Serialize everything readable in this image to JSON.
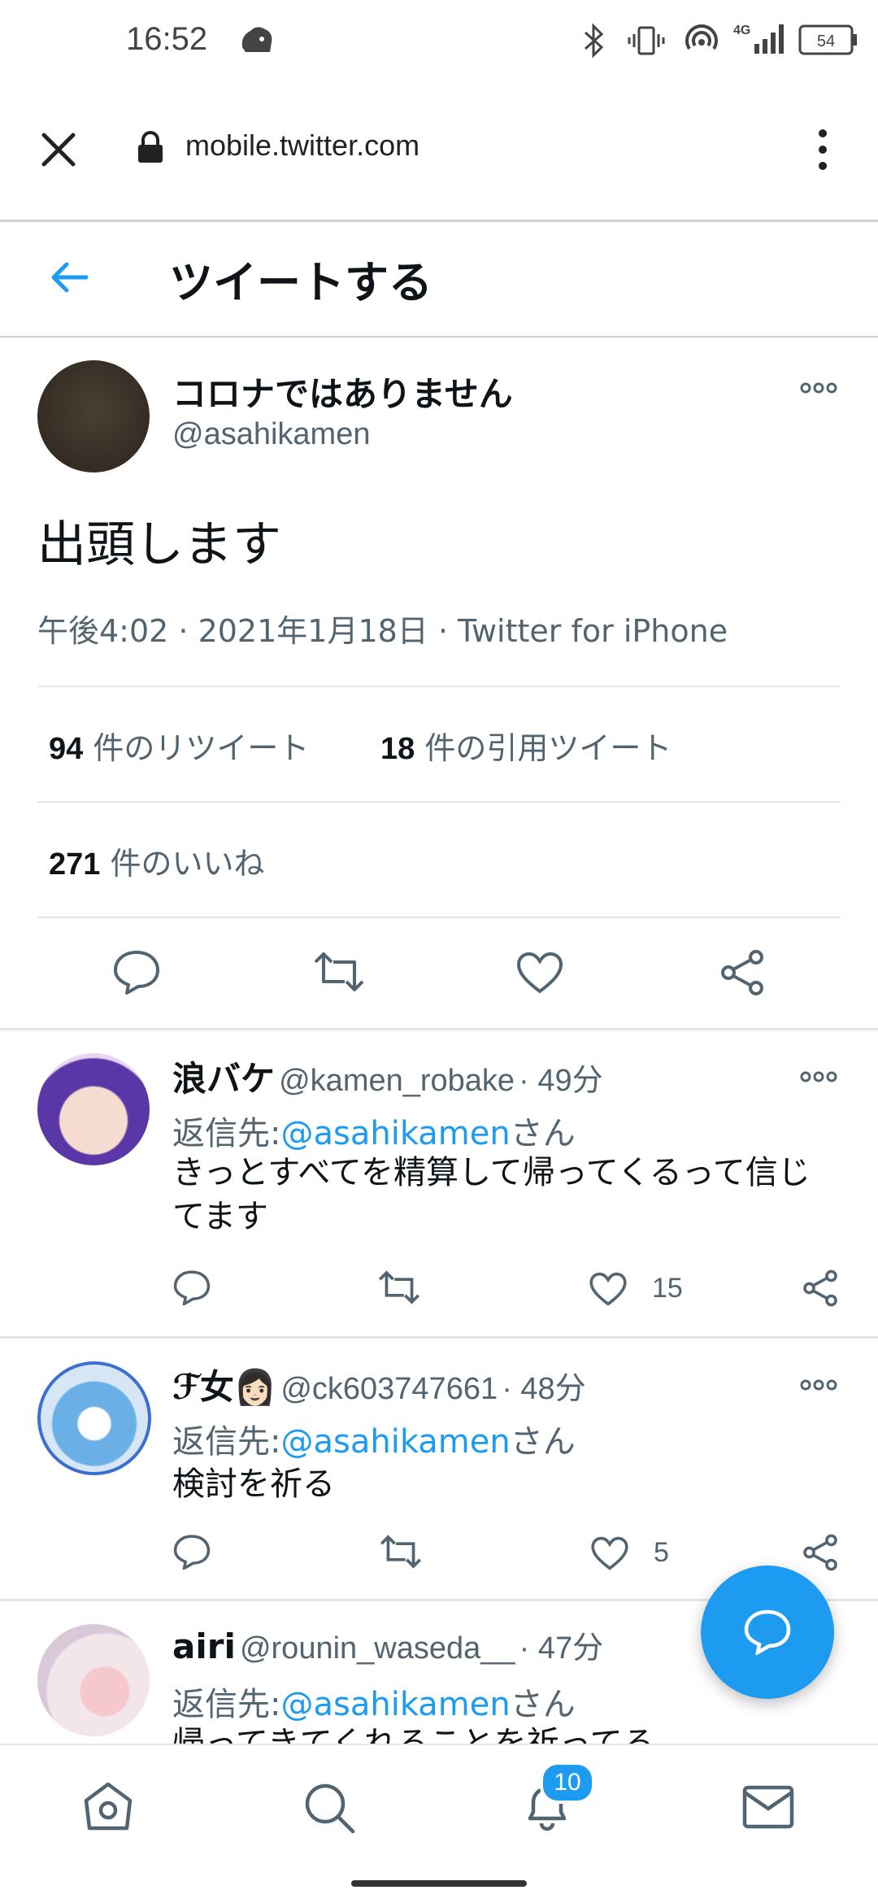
{
  "status_bar": {
    "time": "16:52",
    "battery": "54",
    "network": "4G"
  },
  "browser": {
    "url": "mobile.twitter.com"
  },
  "header": {
    "title": "ツイートする"
  },
  "tweet": {
    "display_name": "コロナではありません",
    "handle": "@asahikamen",
    "text": "出頭します",
    "meta": "午後4:02 · 2021年1月18日 · Twitter for iPhone",
    "retweets_count": "94",
    "retweets_label": "件のリツイート",
    "quotes_count": "18",
    "quotes_label": "件の引用ツイート",
    "likes_count": "271",
    "likes_label": "件のいいね"
  },
  "replies": [
    {
      "display_name": "浪バケ",
      "handle": "@kamen_robake",
      "time": "· 49分",
      "reply_to_prefix": "返信先:",
      "reply_to_handle": "@asahikamen",
      "reply_to_suffix": "さん",
      "text_line1": "きっとすべてを精算して帰ってくるって信じ",
      "text_line2": "てます",
      "likes": "15"
    },
    {
      "display_name": "ℱ女👩🏻",
      "handle": "@ck603747661",
      "time": "· 48分",
      "reply_to_prefix": "返信先:",
      "reply_to_handle": "@asahikamen",
      "reply_to_suffix": "さん",
      "text_line1": "検討を祈る",
      "likes": "5"
    },
    {
      "display_name": "airi",
      "handle": "@rounin_waseda__",
      "time": "· 47分",
      "reply_to_prefix": "返信先:",
      "reply_to_handle": "@asahikamen",
      "reply_to_suffix": "さん",
      "text_line1": "帰ってきてくれることを祈ってる"
    }
  ],
  "bottom_nav": {
    "notifications_badge": "10"
  },
  "colors": {
    "accent": "#1d9bf0",
    "text": "#0f1419",
    "secondary": "#536471",
    "divider": "#e1e6ea"
  }
}
